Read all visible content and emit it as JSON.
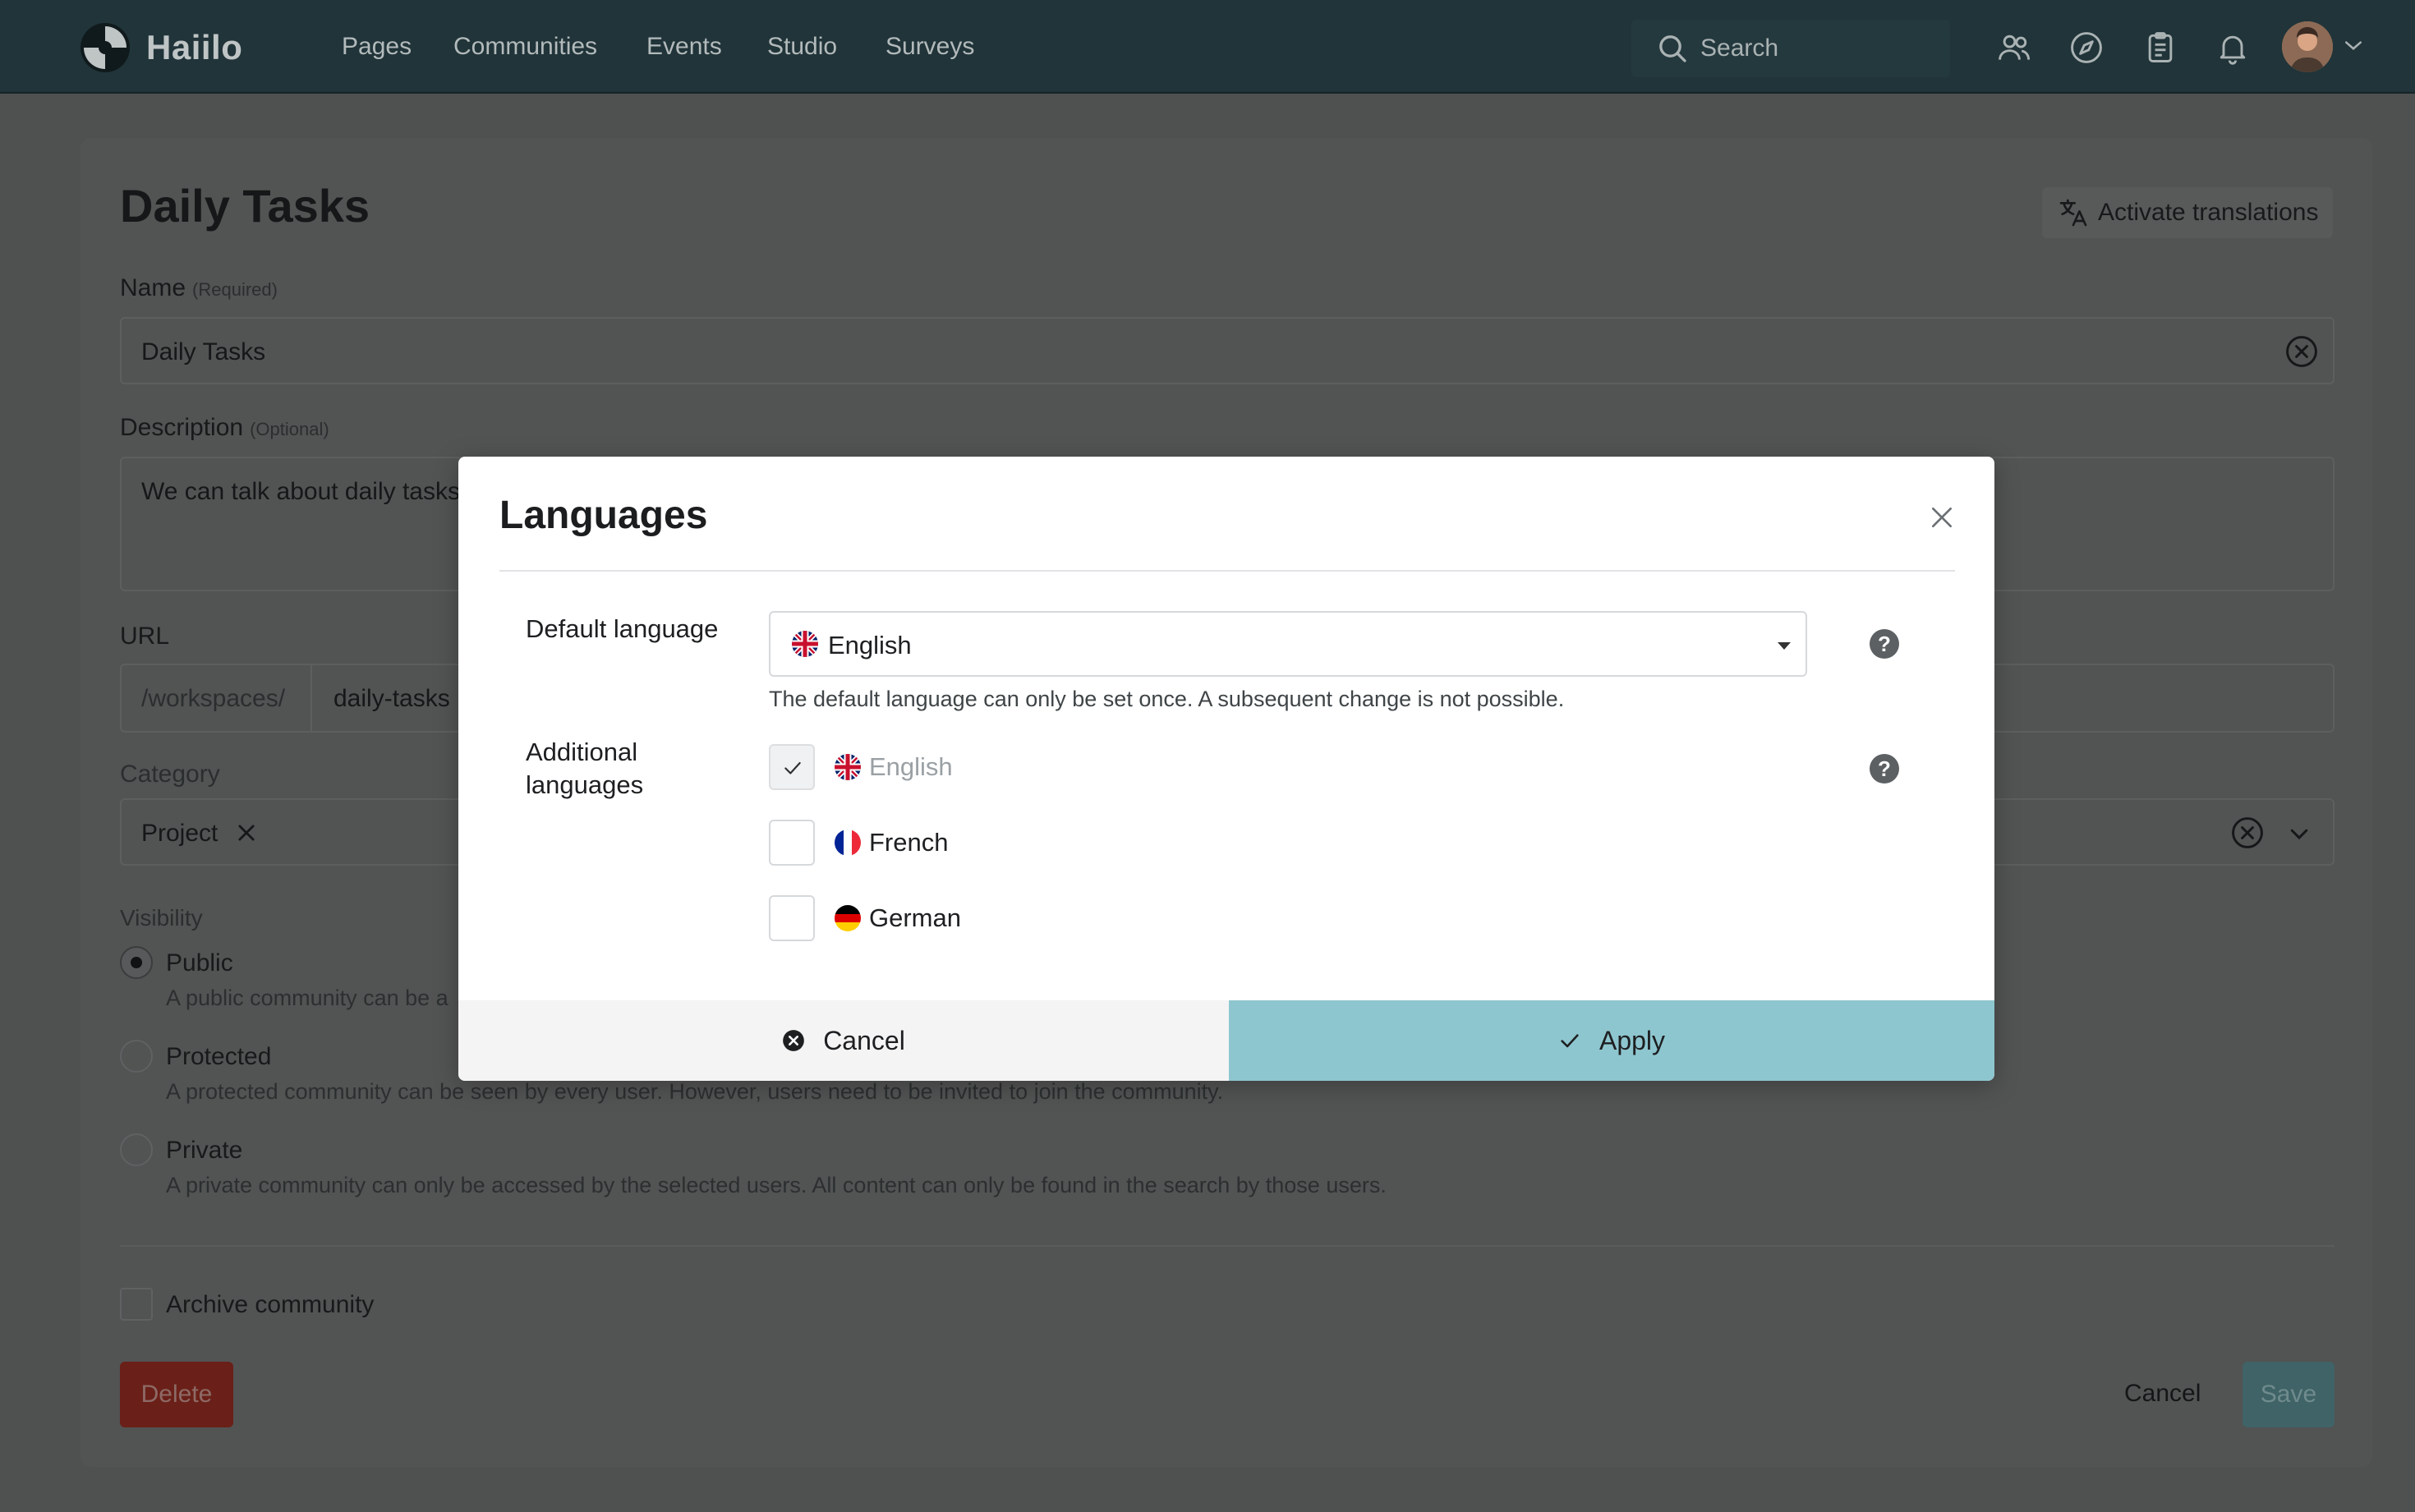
{
  "brand": {
    "name": "Haiilo"
  },
  "nav": {
    "items": [
      "Pages",
      "Communities",
      "Events",
      "Studio",
      "Surveys"
    ],
    "search_label": "Search"
  },
  "page": {
    "title": "Daily Tasks",
    "activate_translations": "Activate translations",
    "name_label": "Name",
    "name_hint": "(Required)",
    "name_value": "Daily Tasks",
    "description_label": "Description",
    "description_hint": "(Optional)",
    "description_value": "We can talk about daily tasks",
    "url_label": "URL",
    "url_prefix": "/workspaces/",
    "url_value": "daily-tasks",
    "category_label": "Category",
    "category_chip": "Project",
    "visibility_label": "Visibility",
    "visibility": [
      {
        "label": "Public",
        "desc": "A public community can be a",
        "selected": true
      },
      {
        "label": "Protected",
        "desc": "A protected community can be seen by every user. However, users need to be invited to join the community.",
        "selected": false
      },
      {
        "label": "Private",
        "desc": "A private community can only be accessed by the selected users. All content can only be found in the search by those users.",
        "selected": false
      }
    ],
    "archive_label": "Archive community",
    "delete_label": "Delete",
    "cancel_label": "Cancel",
    "save_label": "Save"
  },
  "modal": {
    "title": "Languages",
    "default_label": "Default language",
    "default_value": "English",
    "default_hint": "The default language can only be set once. A subsequent change is not possible.",
    "additional_label_1": "Additional",
    "additional_label_2": "languages",
    "options": [
      {
        "label": "English",
        "checked": true,
        "disabled": true
      },
      {
        "label": "French",
        "checked": false,
        "disabled": false
      },
      {
        "label": "German",
        "checked": false,
        "disabled": false
      }
    ],
    "cancel_label": "Cancel",
    "apply_label": "Apply"
  },
  "colors": {
    "nav_bg": "#203439",
    "overlay_bg": "#4f5050",
    "apply_bg": "#8ec6cf",
    "delete_bg": "#6a2018",
    "save_bg": "#3f6366"
  }
}
